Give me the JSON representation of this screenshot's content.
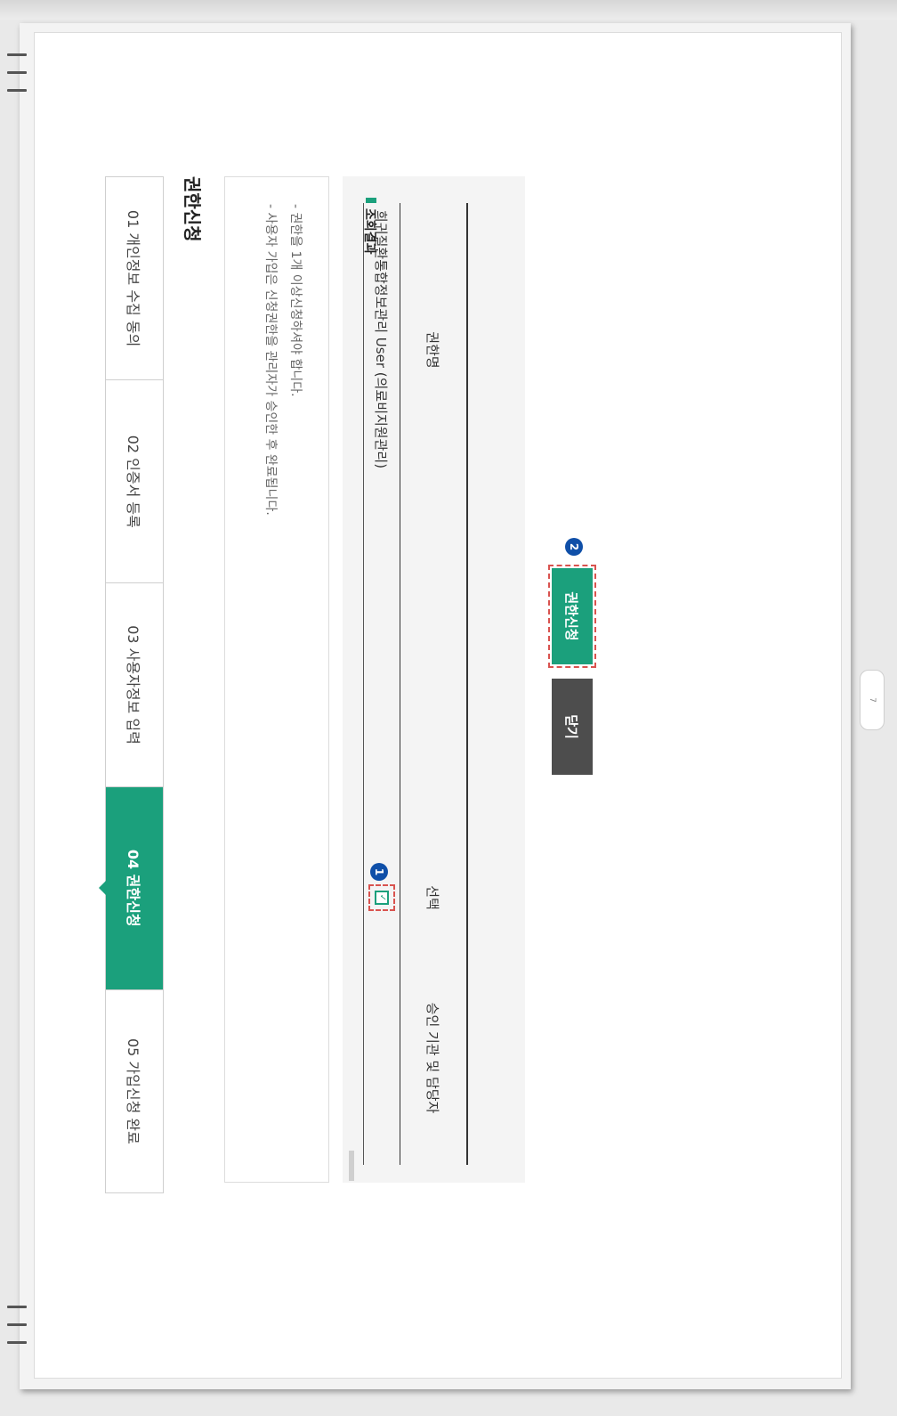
{
  "stepper": {
    "steps": [
      {
        "label": "01 개인정보 수집 동의",
        "active": false
      },
      {
        "label": "02 인증서 등록",
        "active": false
      },
      {
        "label": "03 사용자정보 입력",
        "active": false
      },
      {
        "label": "04 권한신청",
        "active": true
      },
      {
        "label": "05 가입신청 완료",
        "active": false
      }
    ]
  },
  "page_title": "권한신청",
  "notice": {
    "lines": [
      "- 권한을 1개 이상신청하셔야 합니다.",
      "- 사용자 가입은 신청권한을 관리자가 승인한 후 완료됩니다."
    ]
  },
  "result": {
    "title": "조회결과",
    "columns": [
      "권한명",
      "",
      "선택",
      "승인 기관 및 담당자"
    ],
    "rows": [
      {
        "name": "희귀질환통합정보관리",
        "role": "User (의료비지원관리)",
        "checked": true
      }
    ]
  },
  "buttons": {
    "apply": "권한신청",
    "close": "닫기"
  },
  "badges": {
    "one": "1",
    "two": "2"
  },
  "page_tab": "7",
  "colors": {
    "accent": "#1ba07c",
    "badge": "#0f4fa8",
    "highlight": "#d9534f"
  }
}
